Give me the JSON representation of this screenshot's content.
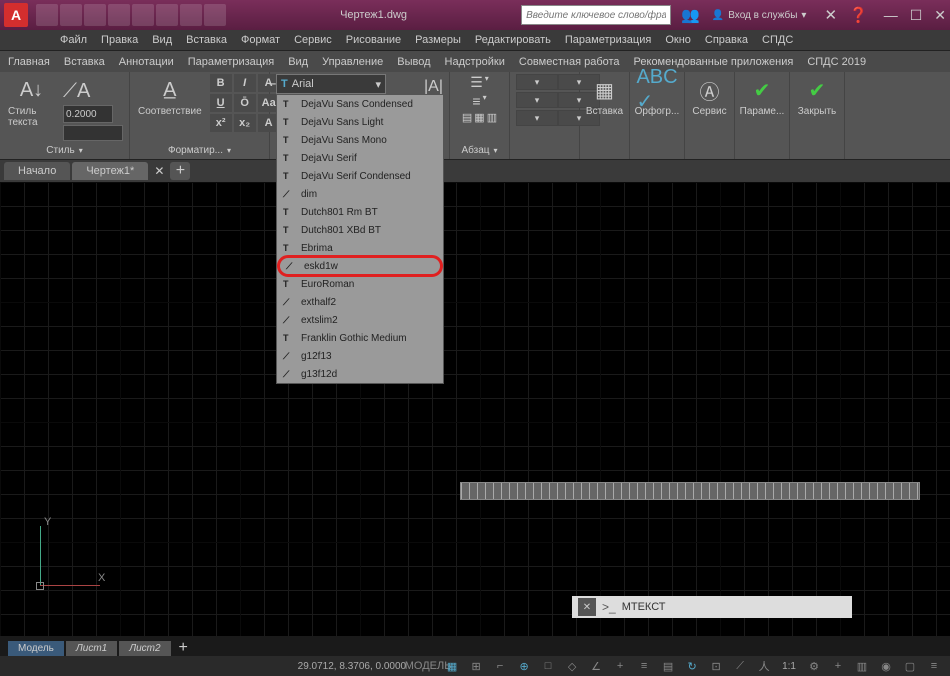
{
  "titlebar": {
    "logo": "A",
    "doc_title": "Чертеж1.dwg",
    "search_placeholder": "Введите ключевое слово/фразу",
    "signin": "Вход в службы"
  },
  "menubar": [
    "Файл",
    "Правка",
    "Вид",
    "Вставка",
    "Формат",
    "Сервис",
    "Рисование",
    "Размеры",
    "Редактировать",
    "Параметризация",
    "Окно",
    "Справка",
    "СПДС"
  ],
  "tabbar": [
    "Главная",
    "Вставка",
    "Аннотации",
    "Параметризация",
    "Вид",
    "Управление",
    "Вывод",
    "Надстройки",
    "Совместная работа",
    "Рекомендованные приложения",
    "СПДС 2019"
  ],
  "ribbon": {
    "style": {
      "big": "Стиль текста",
      "height": "0.2000",
      "label": "Стиль"
    },
    "match": {
      "big": "Соответствие",
      "label": "Форматир..."
    },
    "font_selected": "Arial",
    "paragraph": {
      "label": "Абзац"
    },
    "insert": {
      "big": "Вставка"
    },
    "spell": {
      "big": "Орфогр..."
    },
    "tools": {
      "big": "Сервис"
    },
    "options": {
      "big": "Параме..."
    },
    "close": {
      "big": "Закрыть"
    }
  },
  "fonts": [
    {
      "t": "T",
      "n": "DejaVu Sans Condensed"
    },
    {
      "t": "T",
      "n": "DejaVu Sans Light"
    },
    {
      "t": "T",
      "n": "DejaVu Sans Mono"
    },
    {
      "t": "T",
      "n": "DejaVu Serif"
    },
    {
      "t": "T",
      "n": "DejaVu Serif Condensed"
    },
    {
      "t": "A",
      "n": "dim"
    },
    {
      "t": "T",
      "n": "Dutch801 Rm BT"
    },
    {
      "t": "T",
      "n": "Dutch801 XBd BT"
    },
    {
      "t": "T",
      "n": "Ebrima"
    },
    {
      "t": "A",
      "n": "eskd1w",
      "hl": true
    },
    {
      "t": "T",
      "n": "EuroRoman"
    },
    {
      "t": "A",
      "n": "exthalf2"
    },
    {
      "t": "A",
      "n": "extslim2"
    },
    {
      "t": "T",
      "n": "Franklin Gothic Medium"
    },
    {
      "t": "A",
      "n": "g12f13"
    },
    {
      "t": "A",
      "n": "g13f12d"
    }
  ],
  "doctabs": {
    "start": "Начало",
    "active": "Чертеж1*"
  },
  "ucs": {
    "y": "Y",
    "x": "X"
  },
  "cmd": {
    "text": "МТЕКСТ",
    "prompt": ">_"
  },
  "modeltabs": {
    "model": "Модель",
    "l1": "Лист1",
    "l2": "Лист2"
  },
  "status": {
    "coords": "29.0712, 8.3706, 0.0000",
    "model": "МОДЕЛЬ",
    "scale": "1:1"
  }
}
